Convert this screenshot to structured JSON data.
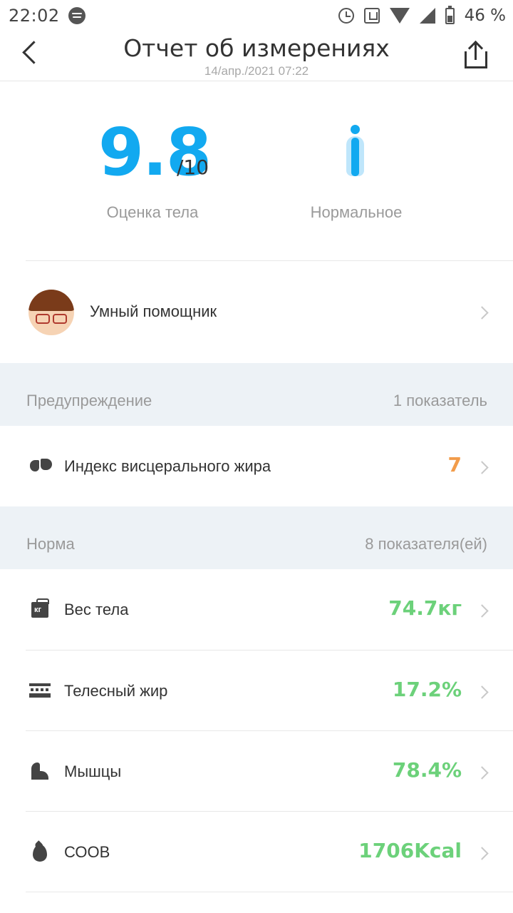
{
  "status_bar": {
    "time": "22:02",
    "battery": "46 %"
  },
  "header": {
    "title": "Отчет об измерениях",
    "subtitle": "14/апр./2021 07:22"
  },
  "score": {
    "value": "9.8",
    "denominator": "/10",
    "label": "Оценка тела",
    "body_type_label": "Нормальное"
  },
  "assistant": {
    "label": "Умный помощник"
  },
  "warning_section": {
    "title": "Предупреждение",
    "count": "1 показатель",
    "items": [
      {
        "label": "Индекс висцерального жира",
        "value": "7",
        "icon": "lung-icon"
      }
    ]
  },
  "normal_section": {
    "title": "Норма",
    "count": "8 показателя(ей)",
    "items": [
      {
        "label": "Вес тела",
        "value": "74.7кг",
        "icon": "weight-icon"
      },
      {
        "label": "Телесный жир",
        "value": "17.2%",
        "icon": "fat-layer-icon"
      },
      {
        "label": "Мышцы",
        "value": "78.4%",
        "icon": "muscle-icon"
      },
      {
        "label": "СООВ",
        "value": "1706Kcal",
        "icon": "flame-icon"
      }
    ]
  },
  "icons": {
    "weight_icon_text": "кг"
  },
  "colors": {
    "accent_blue": "#12a9f0",
    "warning_orange": "#f29c4b",
    "normal_green": "#6cd17a",
    "section_bg": "#edf2f6"
  }
}
